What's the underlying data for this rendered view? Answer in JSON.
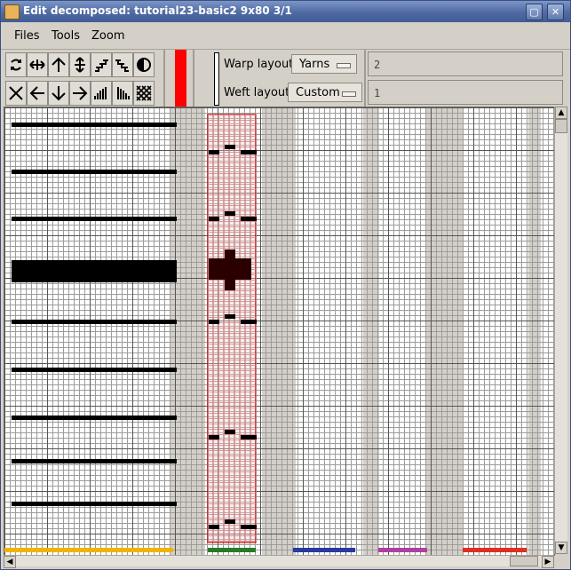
{
  "window": {
    "title": "Edit decomposed: tutorial23-basic2 9x80 3/1"
  },
  "menu": [
    "Files",
    "Tools",
    "Zoom"
  ],
  "toolbar": {
    "row1": [
      "rotate-icon",
      "flip-horizontal-icon",
      "arrow-up-icon",
      "flip-vertical-icon",
      "stair-right-icon",
      "stair-left-icon",
      "half-circle-icon"
    ],
    "row2": [
      "clear-icon",
      "arrow-left-icon",
      "arrow-down-icon",
      "arrow-right-icon",
      "twill-right-icon",
      "twill-left-icon",
      "checker-icon"
    ],
    "active_color": "#ff0000",
    "warp_layout": {
      "label": "Warp layout",
      "value": "Yarns"
    },
    "weft_layout": {
      "label": "Weft layout",
      "value": "Custom"
    },
    "warp_field": "2",
    "weft_field": "1"
  },
  "grid": {
    "columns": 9,
    "rows": 80,
    "colors": {
      "yellow": "#f0b400",
      "green": "#2a7a2a",
      "blue": "#2a3aa0",
      "purple": "#b040a0",
      "red": "#e03020",
      "highlight": "#c00000"
    }
  }
}
